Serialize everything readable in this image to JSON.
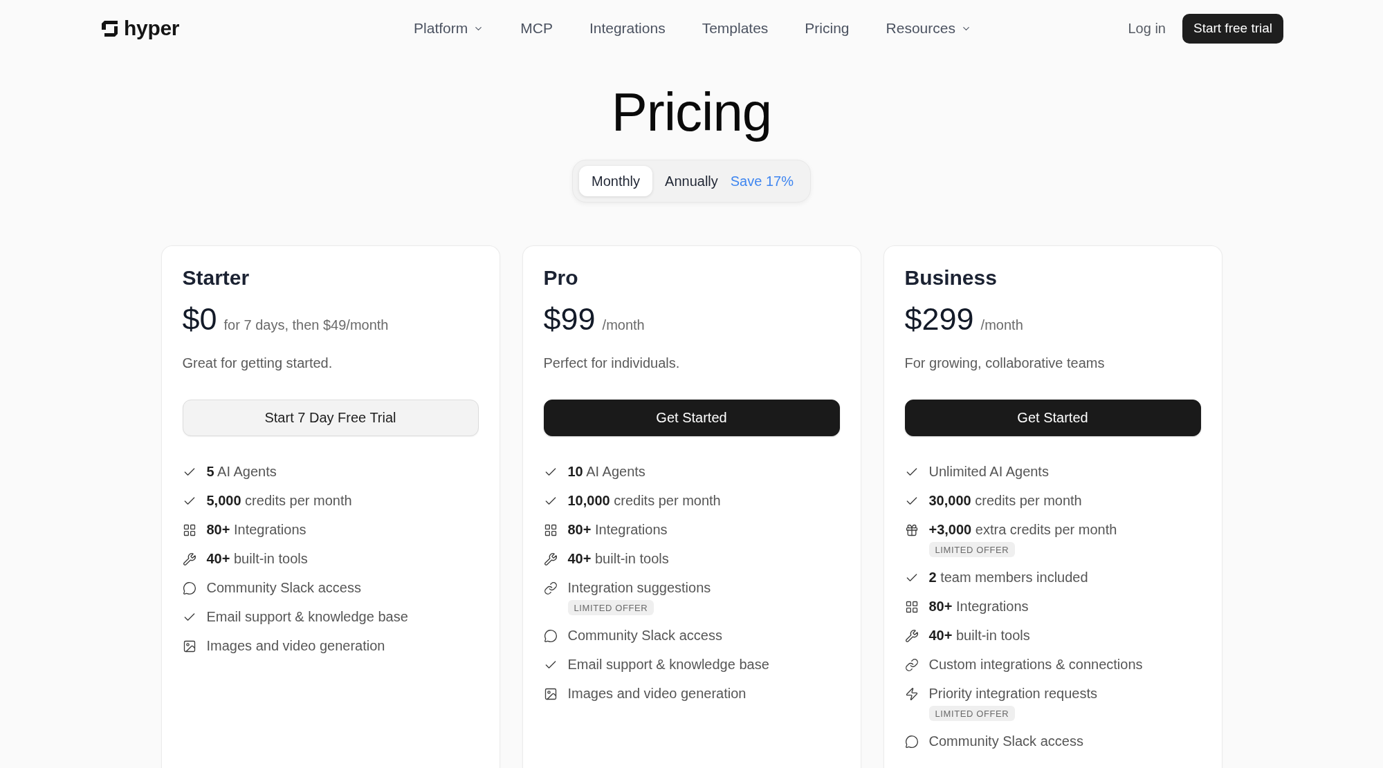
{
  "header": {
    "logo": "hyper",
    "nav": [
      {
        "label": "Platform",
        "dropdown": true
      },
      {
        "label": "MCP",
        "dropdown": false
      },
      {
        "label": "Integrations",
        "dropdown": false
      },
      {
        "label": "Templates",
        "dropdown": false
      },
      {
        "label": "Pricing",
        "dropdown": false
      },
      {
        "label": "Resources",
        "dropdown": true
      }
    ],
    "login": "Log in",
    "cta": "Start free trial"
  },
  "title": "Pricing",
  "billing": {
    "options": [
      {
        "label": "Monthly",
        "selected": true
      },
      {
        "label": "Annually",
        "selected": false
      }
    ],
    "save_note": "Save 17%"
  },
  "plans": [
    {
      "name": "Starter",
      "price": "$0",
      "period": "for 7 days, then $49/month",
      "description": "Great for getting started.",
      "button": {
        "label": "Start 7 Day Free Trial",
        "kind": "secondary"
      },
      "features": [
        {
          "kind": "check",
          "text": "**5** AI Agents"
        },
        {
          "kind": "check",
          "text": "**5,000** credits per month"
        },
        {
          "kind": "grid",
          "text": "**80+** Integrations"
        },
        {
          "kind": "wrench",
          "text": "**40+** built-in tools"
        },
        {
          "kind": "chat",
          "text": "Community Slack access"
        },
        {
          "kind": "check",
          "text": "Email support & knowledge base"
        },
        {
          "kind": "image",
          "text": "Images and video generation"
        }
      ]
    },
    {
      "name": "Pro",
      "price": "$99",
      "period": "/month",
      "description": "Perfect for individuals.",
      "button": {
        "label": "Get Started",
        "kind": "primary"
      },
      "features": [
        {
          "kind": "check",
          "text": "**10** AI Agents"
        },
        {
          "kind": "check",
          "text": "**10,000** credits per month"
        },
        {
          "kind": "grid",
          "text": "**80+** Integrations"
        },
        {
          "kind": "wrench",
          "text": "**40+** built-in tools"
        },
        {
          "kind": "link",
          "text": "Integration suggestions",
          "badge": "LIMITED OFFER"
        },
        {
          "kind": "chat",
          "text": "Community Slack access"
        },
        {
          "kind": "check",
          "text": "Email support & knowledge base"
        },
        {
          "kind": "image",
          "text": "Images and video generation"
        }
      ]
    },
    {
      "name": "Business",
      "price": "$299",
      "period": "/month",
      "description": "For growing, collaborative teams",
      "button": {
        "label": "Get Started",
        "kind": "primary"
      },
      "features": [
        {
          "kind": "check",
          "text": "Unlimited AI Agents"
        },
        {
          "kind": "check",
          "text": "**30,000** credits per month"
        },
        {
          "kind": "gift",
          "text": "**+3,000** extra credits per month",
          "badge": "LIMITED OFFER"
        },
        {
          "kind": "check",
          "text": "**2** team members included"
        },
        {
          "kind": "grid",
          "text": "**80+** Integrations"
        },
        {
          "kind": "wrench",
          "text": "**40+** built-in tools"
        },
        {
          "kind": "link",
          "text": "Custom integrations & connections"
        },
        {
          "kind": "bolt",
          "text": "Priority integration requests",
          "badge": "LIMITED OFFER"
        },
        {
          "kind": "chat",
          "text": "Community Slack access"
        }
      ]
    }
  ]
}
